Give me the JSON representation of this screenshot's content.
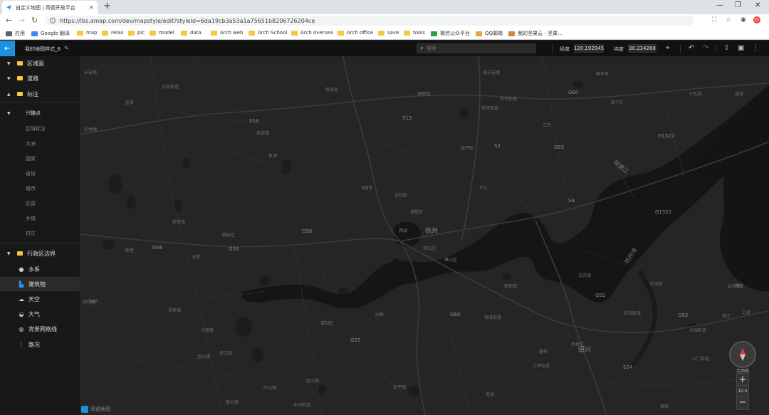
{
  "browser": {
    "tab_title": "自定义地图 | 高德开放平台",
    "url": "https://lbs.amap.com/dev/mapstyle/edit?styleId=6da19cb3a53a1a75651b8206726204ce",
    "bookmarks": [
      {
        "label": "应用",
        "color": "#5f6368"
      },
      {
        "label": "Google 翻译",
        "color": "#4285f4"
      },
      {
        "label": "map",
        "color": "#f6c843"
      },
      {
        "label": "relax",
        "color": "#f6c843"
      },
      {
        "label": "pic",
        "color": "#f6c843"
      },
      {
        "label": "model",
        "color": "#f6c843"
      },
      {
        "label": "data",
        "color": "#f6c843"
      },
      {
        "label": "Arch web",
        "color": "#f6c843"
      },
      {
        "label": "Arch School",
        "color": "#f6c843"
      },
      {
        "label": "Arch oversea",
        "color": "#f6c843"
      },
      {
        "label": "Arch office",
        "color": "#f6c843"
      },
      {
        "label": "save",
        "color": "#f6c843"
      },
      {
        "label": "tools",
        "color": "#f6c843"
      },
      {
        "label": "微信公众平台",
        "color": "#2ba245"
      },
      {
        "label": "QQ邮箱",
        "color": "#e8a63a"
      },
      {
        "label": "我的坚果云 - 坚果...",
        "color": "#c58b3a"
      }
    ]
  },
  "toolbar": {
    "style_name": "我的地图样式_6",
    "search_placeholder": "搜索",
    "lng_label": "经度",
    "lng_value": "120.192945",
    "lat_label": "纬度",
    "lat_value": "30.234268"
  },
  "sidebar": {
    "groups": [
      {
        "label": "区域面",
        "type": "folder"
      },
      {
        "label": "道路",
        "type": "folder"
      },
      {
        "label": "标注",
        "type": "folder-open"
      },
      {
        "label": "兴趣点",
        "type": "sub-open"
      },
      {
        "label": "区域标注",
        "type": "leaf"
      },
      {
        "label": "大洲",
        "type": "leaf"
      },
      {
        "label": "国家",
        "type": "leaf"
      },
      {
        "label": "省份",
        "type": "leaf"
      },
      {
        "label": "城市",
        "type": "leaf"
      },
      {
        "label": "区县",
        "type": "leaf"
      },
      {
        "label": "乡镇",
        "type": "leaf"
      },
      {
        "label": "村庄",
        "type": "leaf"
      },
      {
        "label": "行政区边界",
        "type": "folder"
      },
      {
        "label": "水系",
        "type": "icon",
        "icon": "water-drop-icon",
        "glyph": "●"
      },
      {
        "label": "建筑物",
        "type": "icon-selected",
        "icon": "building-icon",
        "glyph": "▙"
      },
      {
        "label": "天空",
        "type": "icon",
        "icon": "cloud-icon",
        "glyph": "☁"
      },
      {
        "label": "大气",
        "type": "icon",
        "icon": "atmosphere-icon",
        "glyph": "◒"
      },
      {
        "label": "背景网格线",
        "type": "icon",
        "icon": "grid-icon",
        "glyph": "◍"
      },
      {
        "label": "路况",
        "type": "icon",
        "icon": "traffic-icon",
        "glyph": "⋮"
      }
    ]
  },
  "map": {
    "zoom_level": "10.5",
    "logo_text": "高德地图",
    "compass_caption": "北面朝",
    "labels": {
      "hangzhou": "杭州",
      "xihu": "西湖",
      "xiaoshan": "萧山",
      "shaoxing": "绍兴",
      "qiantang": "钱塘江",
      "hangzhou_bay": "杭州湾",
      "g60": "G60",
      "g92": "G92",
      "g25": "G25",
      "g56": "G56",
      "g1522": "G1522",
      "s2": "S2",
      "s9": "S9",
      "s13": "S13",
      "s14": "S14",
      "s24": "S24",
      "yuhang": "余杭区",
      "linping": "临平区",
      "fuyang": "富阳区",
      "binjiang": "滨江区",
      "gongshu": "拱墅区",
      "shangcheng": "上城区",
      "lin_an": "临安区",
      "haining": "海宁市",
      "tongxiang": "桐乡市",
      "keqiao": "柯桥区",
      "deqing": "德清县",
      "pingyao": "瓶窑镇",
      "liangzhu": "良渚",
      "xianlin": "闲林",
      "yanguan": "盐官",
      "xucun": "许村镇",
      "changan": "长安镇",
      "zhouwangmiao": "周王庙镇",
      "yuhang_st": "余杭街道",
      "xiaoshan_st": "萧山区",
      "qiandao": "千岛湖",
      "luqiao": "路桥",
      "yinhu": "银湖",
      "xinggong": "新登镇",
      "changkou": "场口镇",
      "lingqiao": "灵桥镇",
      "tonglu": "桐庐",
      "dayuan": "大源镇",
      "yaqian": "衙前镇",
      "guali": "瓜沥镇",
      "dangwan": "党湾镇",
      "yiqiao": "益农镇",
      "anchang": "安昌街道",
      "qianqing": "钱清街道",
      "sunduan": "孙端街道",
      "doumen": "斗门街道",
      "lanting": "兰亭街道",
      "jianhu": "鉴湖",
      "linjiang": "临江",
      "yuan_jia": "袁家",
      "jinshan": "金山镇",
      "tuanshan": "团山镇",
      "huangshan": "黄山镇",
      "taiping": "太平镇",
      "xindeng": "新登",
      "lushan": "庐山镇",
      "wuchang": "五常",
      "dongzhou": "东洲街道",
      "yinyang": "银杨镇",
      "qiaosi": "乔司街道",
      "tangqi": "塘栖镇",
      "chongxian": "崇贤街道",
      "xiasha": "下沙",
      "jiangdong": "江东",
      "shanhu": "上虞",
      "caoe": "曹娥"
    }
  }
}
